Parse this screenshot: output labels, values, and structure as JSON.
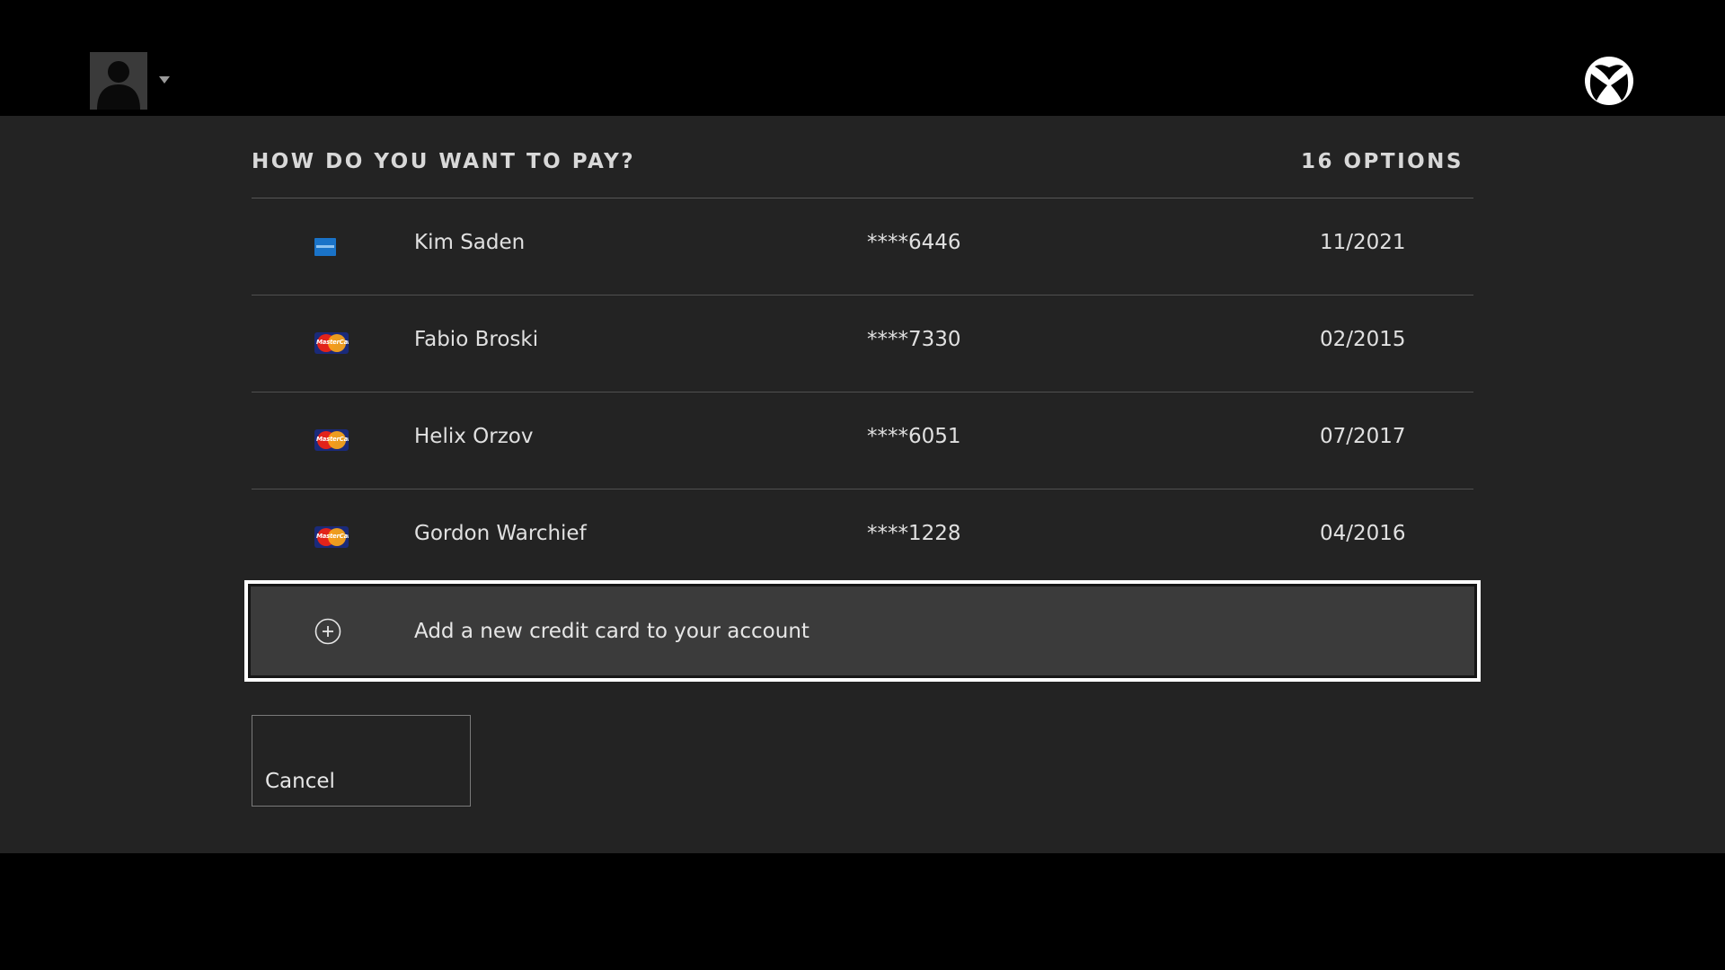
{
  "topbar": {
    "avatar_icon": "person-silhouette-icon",
    "caret_icon": "caret-down-icon",
    "logo_icon": "xbox-logo-icon"
  },
  "header": {
    "title": "HOW DO YOU WANT TO PAY?",
    "count": "16 OPTIONS"
  },
  "payment_methods": [
    {
      "card_type": "amex-icon",
      "name": "Kim Saden",
      "number": "****6446",
      "expiry": "11/2021"
    },
    {
      "card_type": "mastercard-icon",
      "name": "Fabio Broski",
      "number": "****7330",
      "expiry": "02/2015"
    },
    {
      "card_type": "mastercard-icon",
      "name": "Helix Orzov",
      "number": "****6051",
      "expiry": "07/2017"
    },
    {
      "card_type": "mastercard-icon",
      "name": "Gordon Warchief",
      "number": "****1228",
      "expiry": "04/2016"
    }
  ],
  "add_card": {
    "icon": "plus-circle-icon",
    "label": "Add a new credit card to your account"
  },
  "cancel": {
    "label": "Cancel"
  },
  "colors": {
    "background": "#000000",
    "panel": "#232323",
    "focus_border": "#ffffff",
    "focus_fill": "#3b3b3b",
    "amex_blue": "#1a73c8",
    "mastercard_red": "#e2231a",
    "mastercard_orange": "#f7a21b"
  }
}
